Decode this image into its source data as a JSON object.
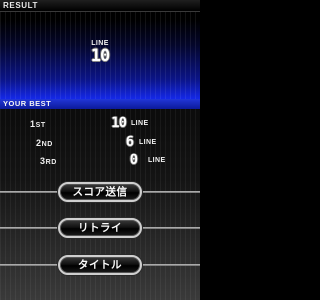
{
  "result": {
    "header_label": "RESULT",
    "line_caption": "LINE",
    "line_value": "10"
  },
  "best": {
    "header_label": "YOUR BEST",
    "ranks": [
      {
        "num": "1",
        "suffix": "ST",
        "value": "10",
        "unit": "LINE"
      },
      {
        "num": "2",
        "suffix": "ND",
        "value": "6",
        "unit": "LINE"
      },
      {
        "num": "3",
        "suffix": "RD",
        "value": "0",
        "unit": "LINE"
      }
    ]
  },
  "buttons": {
    "send_score": "スコア送信",
    "retry": "リトライ",
    "title": "タイトル"
  }
}
